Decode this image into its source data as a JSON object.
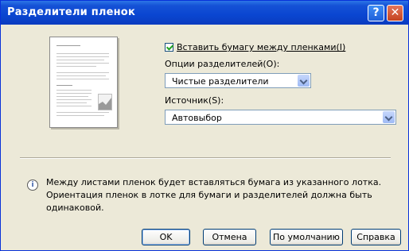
{
  "window": {
    "title": "Разделители пленок",
    "help_icon": "?",
    "close_icon": "✕"
  },
  "options": {
    "insert_paper_label": "Вставить бумагу между пленками(I)",
    "insert_paper_checked": true,
    "separators_label": "Опции разделителей(O):",
    "separators_value": "Чистые разделители",
    "source_label": "Источник(S):",
    "source_value": "Автовыбор"
  },
  "info": {
    "icon": "i",
    "text": "Между листами пленок будет вставляться бумага из указанного лотка. Ориентация пленок в лотке для бумаги и разделителей должна быть одинаковой."
  },
  "buttons": {
    "ok": "OK",
    "cancel": "Отмена",
    "default": "По умолчанию",
    "help": "Справка"
  }
}
